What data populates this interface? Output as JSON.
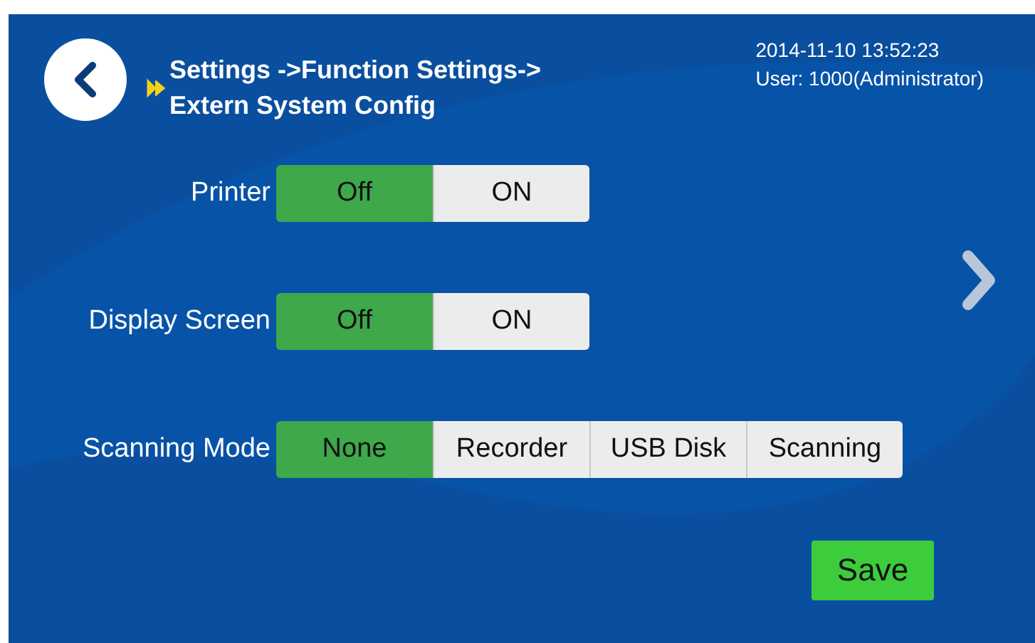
{
  "header": {
    "breadcrumb_line_1": "Settings ->Function Settings->",
    "breadcrumb_line_2": "Extern System Config",
    "datetime": "2014-11-10  13:52:23",
    "user": "User: 1000(Administrator)"
  },
  "settings": [
    {
      "label": "Printer",
      "options": [
        {
          "label": "Off",
          "selected": true
        },
        {
          "label": "ON",
          "selected": false
        }
      ]
    },
    {
      "label": "Display Screen",
      "options": [
        {
          "label": "Off",
          "selected": true
        },
        {
          "label": "ON",
          "selected": false
        }
      ]
    },
    {
      "label": "Scanning Mode",
      "options": [
        {
          "label": "None",
          "selected": true
        },
        {
          "label": "Recorder",
          "selected": false
        },
        {
          "label": "USB Disk",
          "selected": false
        },
        {
          "label": "Scanning",
          "selected": false
        }
      ]
    }
  ],
  "save_button": "Save"
}
